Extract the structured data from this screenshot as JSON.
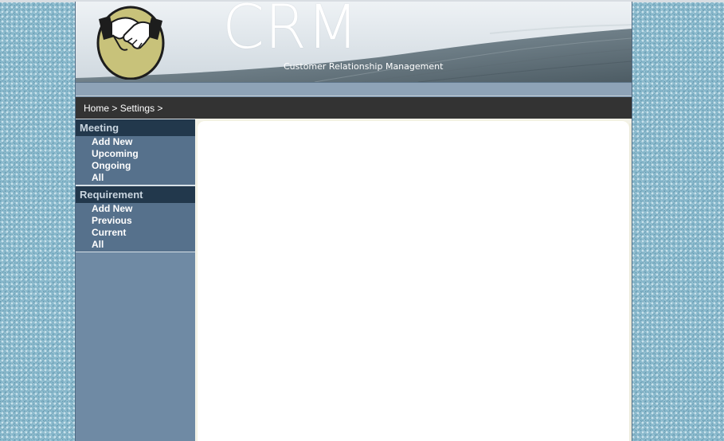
{
  "banner": {
    "logo_icon": "handshake-icon",
    "title": "CRM",
    "subtitle": "Customer Relationship Management"
  },
  "breadcrumb": {
    "home": "Home",
    "settings": "Settings",
    "separator": ">"
  },
  "sidebar": {
    "sections": [
      {
        "heading": "Meeting",
        "items": [
          {
            "label": "Add New"
          },
          {
            "label": "Upcoming"
          },
          {
            "label": "Ongoing"
          },
          {
            "label": "All"
          }
        ]
      },
      {
        "heading": "Requirement",
        "items": [
          {
            "label": "Add New"
          },
          {
            "label": "Previous"
          },
          {
            "label": "Current"
          },
          {
            "label": "All"
          }
        ]
      }
    ]
  },
  "colors": {
    "page_background": "#86b7cb",
    "sidebar": "#6f8aa4",
    "section_heading": "#22384c",
    "breadcrumb_bar": "#333333",
    "logo_circle": "#c8c27a"
  }
}
